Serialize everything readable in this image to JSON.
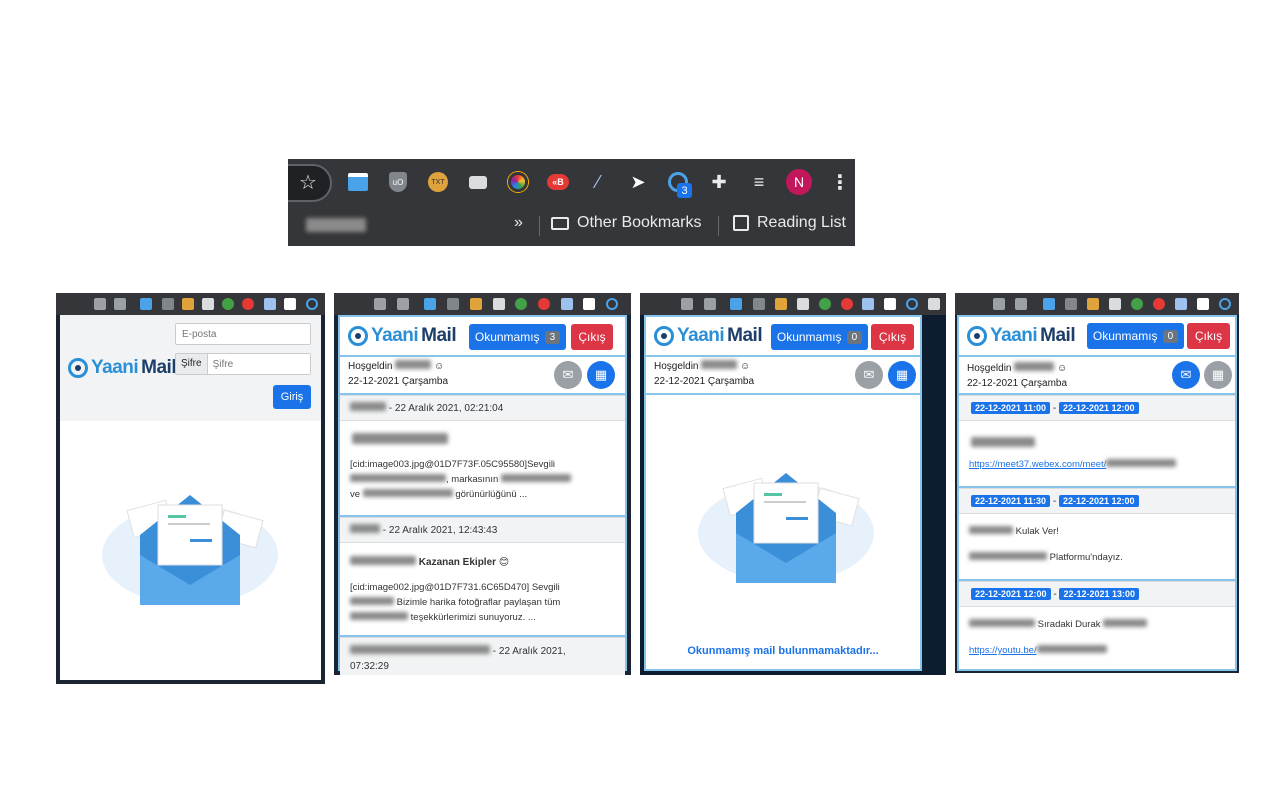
{
  "toolbar": {
    "extension_badge": "3",
    "avatar_letter": "N",
    "chevron": "»",
    "other_bookmarks": "Other Bookmarks",
    "reading_list": "Reading List"
  },
  "login": {
    "email_placeholder": "E-posta",
    "password_label": "Şifre",
    "password_placeholder": "Şifre",
    "login_button": "Giriş"
  },
  "brand": {
    "logo_y": "Yaani",
    "logo_mail": "Mail"
  },
  "header": {
    "unread_label": "Okunmamış",
    "exit_label": "Çıkış"
  },
  "inbox": {
    "unread_count": "3",
    "greeting": "Hoşgeldin",
    "date": "22-12-2021 Çarşamba",
    "mails": [
      {
        "date": "- 22 Aralık 2021, 02:21:04",
        "body1": "[cid:image003.jpg@01D7F73F.05C95580]Sevgili",
        "body2": ", markasının",
        "body3": "ve",
        "body4": "görünürlüğünü ..."
      },
      {
        "date": "- 22 Aralık 2021, 12:43:43",
        "subject": "Kazanan Ekipler 😊",
        "body1": "[cid:image002.jpg@01D7F731.6C65D470] Sevgili",
        "body2": "Bizimle harika fotoğraflar paylaşan tüm",
        "body3": "teşekkürlerimizi sunuyoruz. ..."
      },
      {
        "date": "- 22 Aralık 2021,",
        "date2": "07:32:29"
      }
    ]
  },
  "empty": {
    "unread_count": "0",
    "greeting": "Hoşgeldin",
    "date": "22-12-2021 Çarşamba",
    "message": "Okunmamış mail bulunmamaktadır..."
  },
  "calendar": {
    "unread_count": "0",
    "greeting": "Hoşgeldin",
    "date": "22-12-2021 Çarşamba",
    "events": [
      {
        "start": "22-12-2021 11:00",
        "end": "22-12-2021 12:00",
        "link": "https://meet37.webex.com/meet/"
      },
      {
        "start": "22-12-2021 11:30",
        "end": "22-12-2021 12:00",
        "line1": "Kulak Ver!",
        "line2": "Platformu'ndayız."
      },
      {
        "start": "22-12-2021 12:00",
        "end": "22-12-2021 13:00",
        "line1": "Sıradaki Durak",
        "link": "https://youtu.be/"
      }
    ],
    "dash": "-"
  },
  "colors": {
    "primary": "#1a73e8",
    "danger": "#dc3545",
    "brand_dark": "#1e3e6a",
    "brand_light": "#2a8fd6",
    "toolbar": "#35363a"
  }
}
